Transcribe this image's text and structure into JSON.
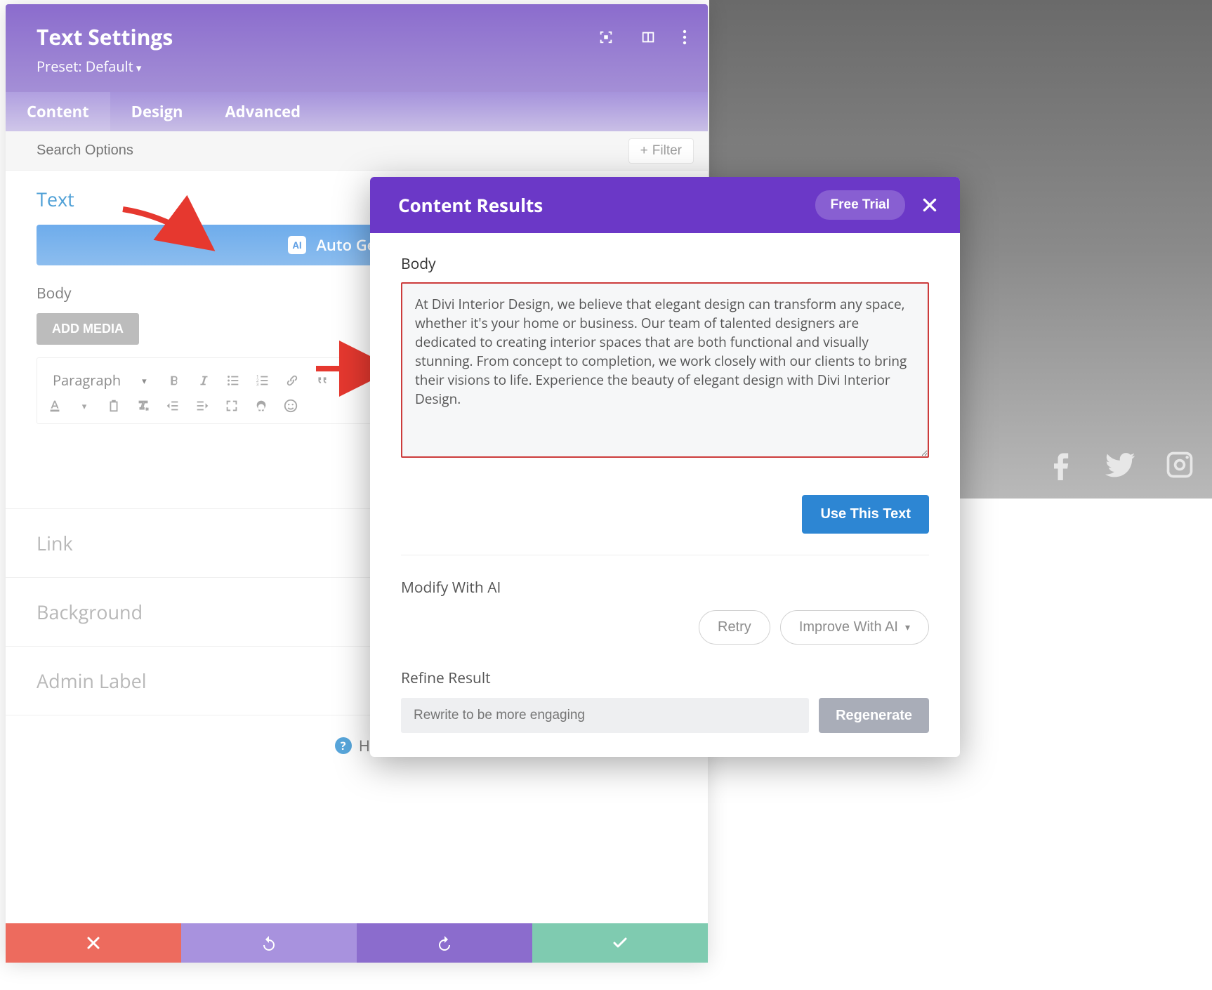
{
  "settings": {
    "title": "Text Settings",
    "preset_label": "Preset: Default",
    "tabs": [
      "Content",
      "Design",
      "Advanced"
    ],
    "active_tab": 0,
    "search_placeholder": "Search Options",
    "filter_label": "Filter",
    "text_section_title": "Text",
    "auto_generate_label": "Auto Generate",
    "body_label": "Body",
    "add_media_label": "ADD MEDIA",
    "paragraph_label": "Paragraph",
    "collapsed_sections": [
      "Link",
      "Background",
      "Admin Label"
    ],
    "help_label": "He"
  },
  "arrows": {
    "present": true
  },
  "modal": {
    "title": "Content Results",
    "free_trial_label": "Free Trial",
    "body_label": "Body",
    "body_text": "At Divi Interior Design, we believe that elegant design can transform any space, whether it's your home or business. Our team of talented designers are dedicated to creating interior spaces that are both functional and visually stunning. From concept to completion, we work closely with our clients to bring their visions to life. Experience the beauty of elegant design with Divi Interior Design.",
    "use_label": "Use This Text",
    "modify_label": "Modify With AI",
    "retry_label": "Retry",
    "improve_label": "Improve With AI",
    "refine_label": "Refine Result",
    "refine_placeholder": "Rewrite to be more engaging",
    "regenerate_label": "Regenerate"
  }
}
